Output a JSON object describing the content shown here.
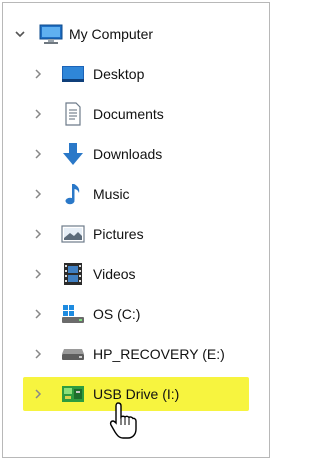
{
  "tree": {
    "root": {
      "label": "My Computer",
      "icon": "monitor-icon",
      "expanded": true
    },
    "items": [
      {
        "label": "Desktop",
        "icon": "desktop-icon"
      },
      {
        "label": "Documents",
        "icon": "documents-icon"
      },
      {
        "label": "Downloads",
        "icon": "download-arrow-icon"
      },
      {
        "label": "Music",
        "icon": "music-note-icon"
      },
      {
        "label": "Pictures",
        "icon": "pictures-icon"
      },
      {
        "label": "Videos",
        "icon": "videos-film-icon"
      },
      {
        "label": "OS (C:)",
        "icon": "windows-drive-icon"
      },
      {
        "label": "HP_RECOVERY (E:)",
        "icon": "hard-drive-icon"
      },
      {
        "label": "USB Drive (I:)",
        "icon": "usb-drive-icon",
        "highlighted": true
      }
    ]
  },
  "colors": {
    "highlight": "#f7f43f",
    "folder_blue": "#2a78c8",
    "chevron": "#7a7a7a"
  },
  "cursor": {
    "icon": "hand-pointer-icon"
  }
}
